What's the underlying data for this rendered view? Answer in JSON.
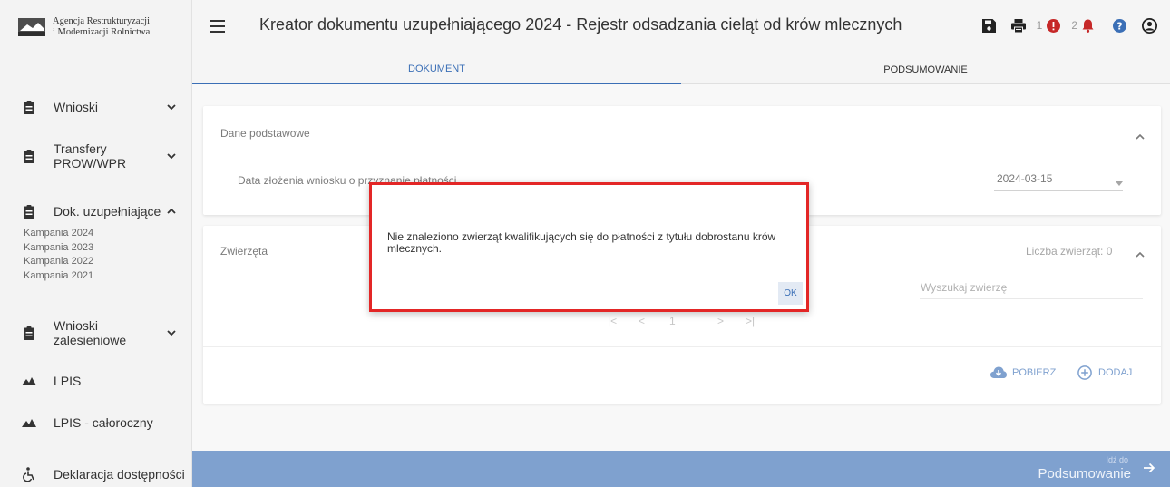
{
  "brand": {
    "line1": "Agencja Restrukturyzacji",
    "line2": "i Modernizacji Rolnictwa"
  },
  "header": {
    "title": "Kreator dokumentu uzupełniającego 2024 - Rejestr odsadzania cieląt od krów mlecznych",
    "error_count": "1",
    "notification_count": "2"
  },
  "sidebar": {
    "items": [
      {
        "label": "Wnioski",
        "chevron": "down"
      },
      {
        "label": "Transfery PROW/WPR",
        "chevron": "down"
      },
      {
        "label": "Dok. uzupełniające",
        "chevron": "up"
      },
      {
        "label": "Wnioski zalesieniowe",
        "chevron": "down"
      },
      {
        "label": "LPIS",
        "chevron": ""
      },
      {
        "label": "LPIS - całoroczny",
        "chevron": ""
      },
      {
        "label": "Deklaracja dostępności",
        "chevron": ""
      }
    ],
    "sub_items": [
      "Kampania 2024",
      "Kampania 2023",
      "Kampania 2022",
      "Kampania 2021"
    ]
  },
  "tabs": [
    {
      "label": "DOKUMENT",
      "active": true
    },
    {
      "label": "PODSUMOWANIE",
      "active": false
    }
  ],
  "basic_data": {
    "title": "Dane podstawowe",
    "date_label": "Data złożenia wniosku o przyznanie płatności",
    "date_value": "2024-03-15"
  },
  "animals": {
    "title": "Zwierzęta",
    "count_label": "Liczba zwierząt: 0",
    "search_placeholder": "Wyszukaj zwierzę",
    "pager": {
      "first": "|<",
      "prev": "<",
      "page": "1",
      "next": ">",
      "last": ">|"
    },
    "download_label": "POBIERZ",
    "add_label": "DODAJ"
  },
  "dialog": {
    "message": "Nie znaleziono zwierząt kwalifikujących się do płatności z tytułu dobrostanu krów mlecznych.",
    "ok_label": "OK"
  },
  "footer": {
    "hint": "Idź do",
    "label": "Podsumowanie"
  },
  "colors": {
    "primary": "#3b6fb6",
    "error": "#c62828",
    "highlight_border": "#e32626"
  }
}
